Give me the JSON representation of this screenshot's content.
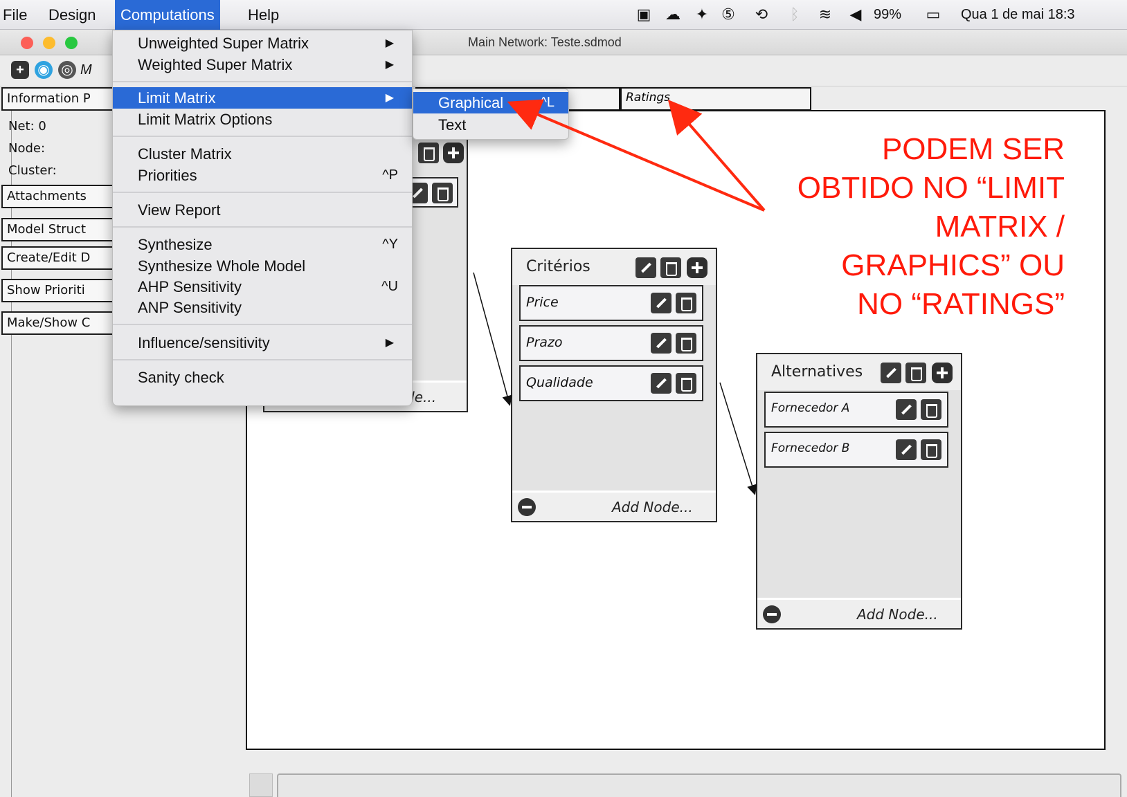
{
  "menubar": {
    "items": [
      {
        "label": "File"
      },
      {
        "label": "Design"
      },
      {
        "label": "Computations"
      },
      {
        "label": "Help"
      }
    ],
    "status": {
      "battery": "99%",
      "clock": "Qua 1 de mai 18:3"
    }
  },
  "window": {
    "title": "Main Network: Teste.sdmod",
    "toolbar_label": "M"
  },
  "left_panel": {
    "information_tab": "Information P",
    "net": "Net: 0",
    "node": "Node:",
    "cluster": "Cluster:",
    "buttons": [
      "Attachments",
      "Model Struct",
      "Create/Edit D",
      "Show Prioriti",
      "Make/Show C"
    ]
  },
  "tabs": {
    "ratings": "Ratings"
  },
  "computations_menu": {
    "items": [
      {
        "label": "Unweighted Super Matrix",
        "arrow": "▶"
      },
      {
        "label": "Weighted Super Matrix",
        "arrow": "▶"
      },
      {
        "label": "Limit Matrix",
        "arrow": "▶"
      },
      {
        "label": "Limit Matrix Options"
      },
      {
        "label": "Cluster Matrix"
      },
      {
        "label": "Priorities",
        "shortcut": "^P"
      },
      {
        "label": "View Report"
      },
      {
        "label": "Synthesize",
        "shortcut": "^Y"
      },
      {
        "label": "Synthesize Whole Model"
      },
      {
        "label": "AHP Sensitivity",
        "shortcut": "^U"
      },
      {
        "label": "ANP Sensitivity"
      },
      {
        "label": "Influence/sensitivity",
        "arrow": "▶"
      },
      {
        "label": "Sanity check"
      }
    ]
  },
  "limit_matrix_submenu": {
    "items": [
      {
        "label": "Graphical",
        "shortcut": "^L"
      },
      {
        "label": "Text"
      }
    ]
  },
  "clusters": {
    "partial": {
      "add_node": "de..."
    },
    "criterios": {
      "title": "Critérios",
      "nodes": [
        "Price",
        "Prazo",
        "Qualidade"
      ],
      "add_node": "Add Node..."
    },
    "alternatives": {
      "title": "Alternatives",
      "nodes": [
        "Fornecedor A",
        "Fornecedor B"
      ],
      "add_node": "Add Node..."
    }
  },
  "annotation": {
    "lines": [
      "PODEM SER",
      "OBTIDO NO “LIMIT",
      "MATRIX /",
      "GRAPHICS” OU",
      "NO “RATINGS”"
    ],
    "color": "#ff1a0a"
  },
  "colors": {
    "menu_highlight": "#2a6ad6",
    "annotation": "#ff1a0a"
  }
}
